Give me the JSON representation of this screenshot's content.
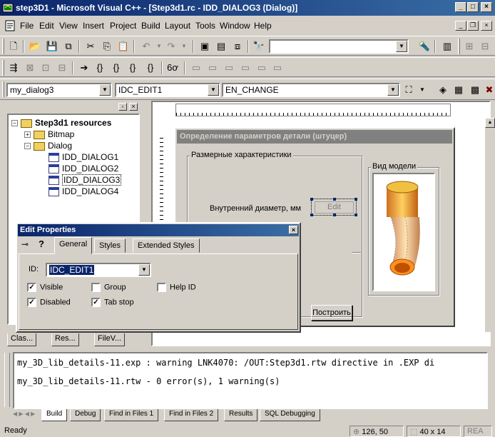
{
  "window": {
    "title": "step3D1 - Microsoft Visual C++ - [Step3d1.rc - IDD_DIALOG3 (Dialog)]"
  },
  "menu": [
    "File",
    "Edit",
    "View",
    "Insert",
    "Project",
    "Build",
    "Layout",
    "Tools",
    "Window",
    "Help"
  ],
  "wizardbar": {
    "class": "my_dialog3",
    "id": "IDC_EDIT1",
    "message": "EN_CHANGE"
  },
  "tree": {
    "root": "Step3d1 resources",
    "bitmap": "Bitmap",
    "dialog": "Dialog",
    "dialogs": [
      "IDD_DIALOG1",
      "IDD_DIALOG2",
      "IDD_DIALOG3",
      "IDD_DIALOG4"
    ],
    "selected": "IDD_DIALOG3"
  },
  "workspace_tabs": [
    "Clas...",
    "Res...",
    "FileV..."
  ],
  "dialog_design": {
    "title": "Определение параметров детали (штуцер)",
    "group1": "Размерные характеристики",
    "label_diameter": "Внутренний диаметр, мм",
    "edit_text": "Edit",
    "group2": "Вид модели",
    "button_build": "Построить"
  },
  "properties": {
    "title": "Edit Properties",
    "tabs": [
      "General",
      "Styles",
      "Extended Styles"
    ],
    "id_label": "ID:",
    "id_value": "IDC_EDIT1",
    "visible": "Visible",
    "group": "Group",
    "help_id": "Help ID",
    "disabled": "Disabled",
    "tab_stop": "Tab stop",
    "checked": {
      "visible": true,
      "group": false,
      "help_id": false,
      "disabled": true,
      "tab_stop": true
    }
  },
  "output": {
    "lines": [
      "my_3D_lib_details-11.exp : warning LNK4070: /OUT:Step3d1.rtw directive in .EXP di",
      "my_3D_lib_details-11.rtw - 0 error(s), 1 warning(s)"
    ],
    "tabs": [
      "Build",
      "Debug",
      "Find in Files 1",
      "Find in Files 2",
      "Results",
      "SQL Debugging"
    ]
  },
  "status": {
    "text": "Ready",
    "pos": "126, 50",
    "size": "40 x 14",
    "mode": "REA"
  },
  "colors": {
    "title_active": "#0a246a",
    "title_inactive": "#808080",
    "selection": "#0a246a"
  }
}
